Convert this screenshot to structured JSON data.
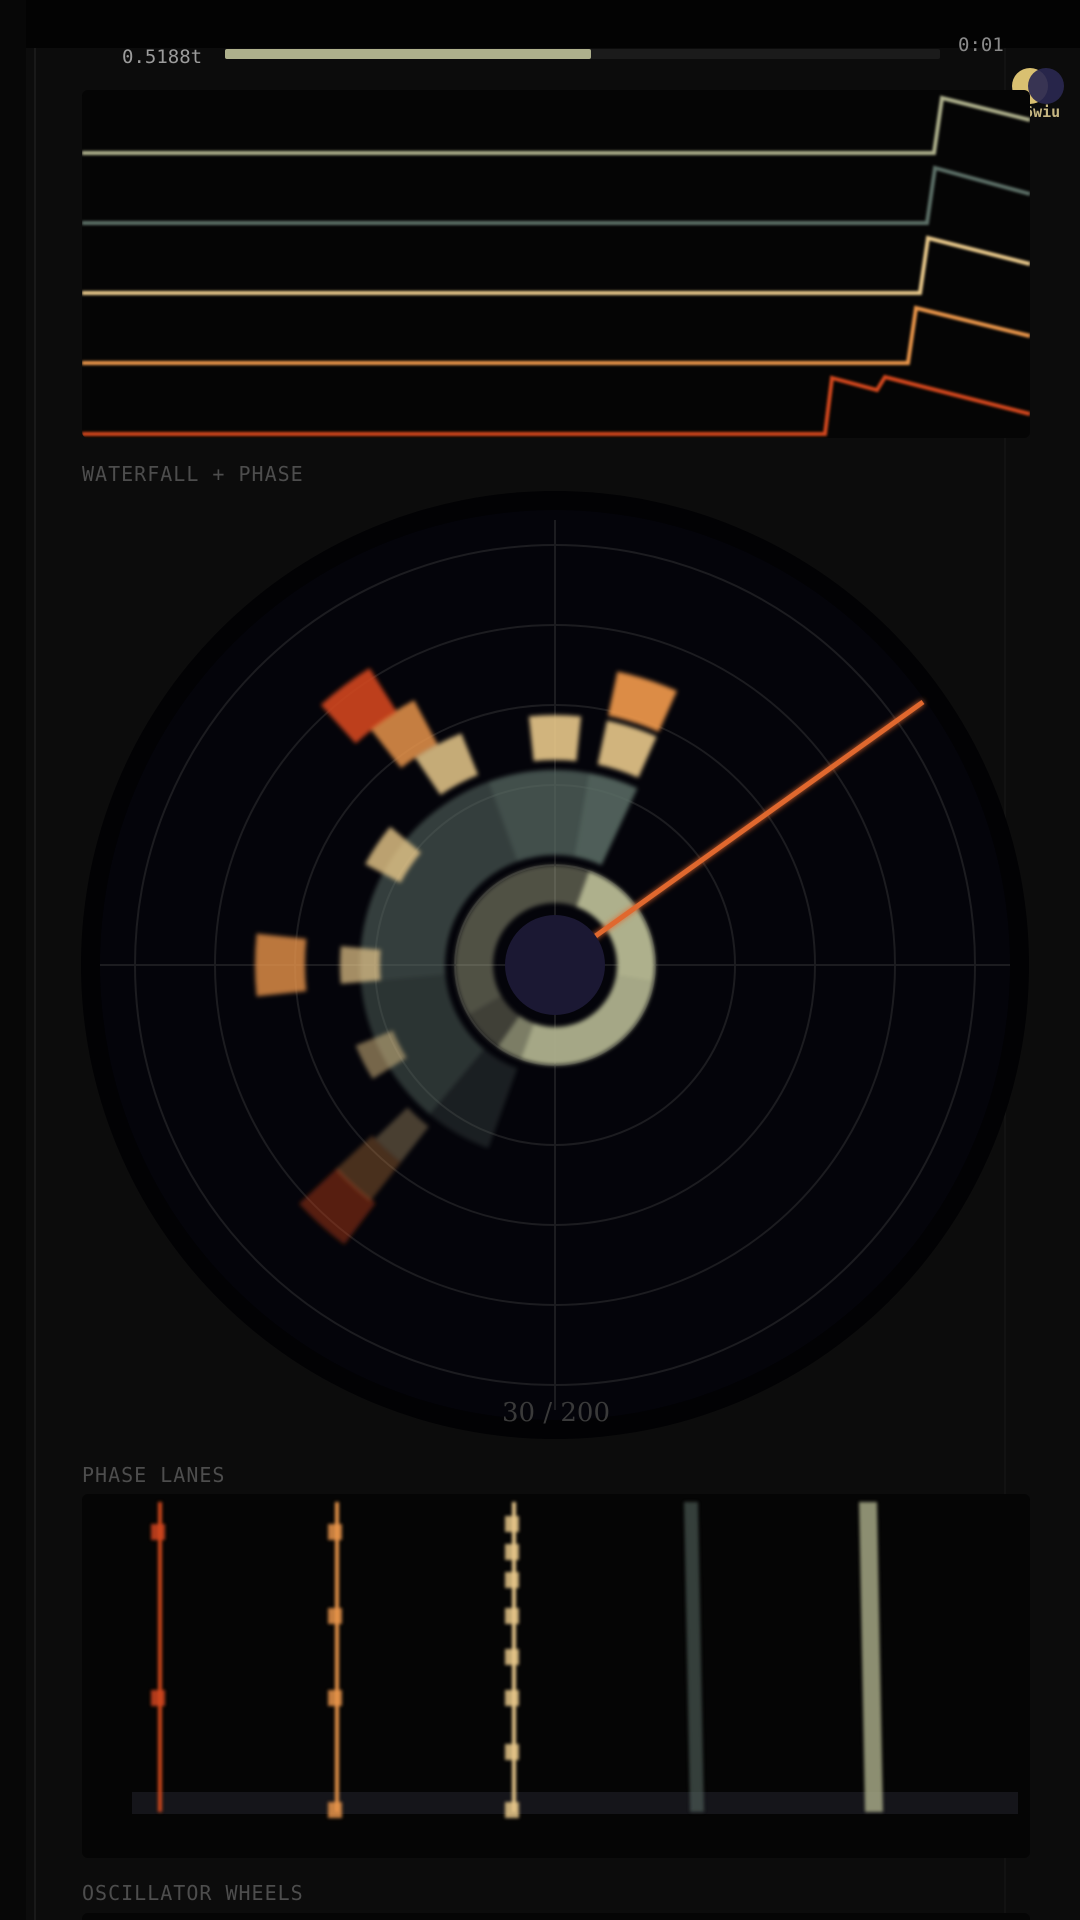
{
  "header": {
    "progress_label": "0.5188t",
    "progress_value": 0.512,
    "right_readout": "0:01",
    "user_label": "lh6wiu",
    "avatar_colors": [
      "#d9c071",
      "#2a2850"
    ]
  },
  "sections": {
    "waterfall_label": "WATERFALL + PHASE",
    "lanes_label": "PHASE LANES",
    "oscillator_label": "OSCILLATOR WHEELS"
  },
  "wheel": {
    "counter": "30 / 200",
    "hand_color": "#e0682e",
    "hub_color": "#1b1833"
  },
  "palette": {
    "sage": "#aeb08c",
    "slate": "#5c6e66",
    "tan": "#e8c88a",
    "orange": "#e8944a",
    "red": "#d2461e"
  },
  "step_traces": [
    {
      "color": "#aeb08c"
    },
    {
      "color": "#5c6e66"
    },
    {
      "color": "#e8c88a"
    },
    {
      "color": "#e8944a"
    },
    {
      "color": "#d2461e"
    }
  ],
  "lanes": [
    {
      "label": "",
      "color": "#d2461e"
    },
    {
      "label": "",
      "color": "#e8944a"
    },
    {
      "label": "",
      "color": "#e8c88a"
    },
    {
      "label": "",
      "color": "#5c6e66"
    },
    {
      "label": "",
      "color": "#aeb08c"
    }
  ]
}
